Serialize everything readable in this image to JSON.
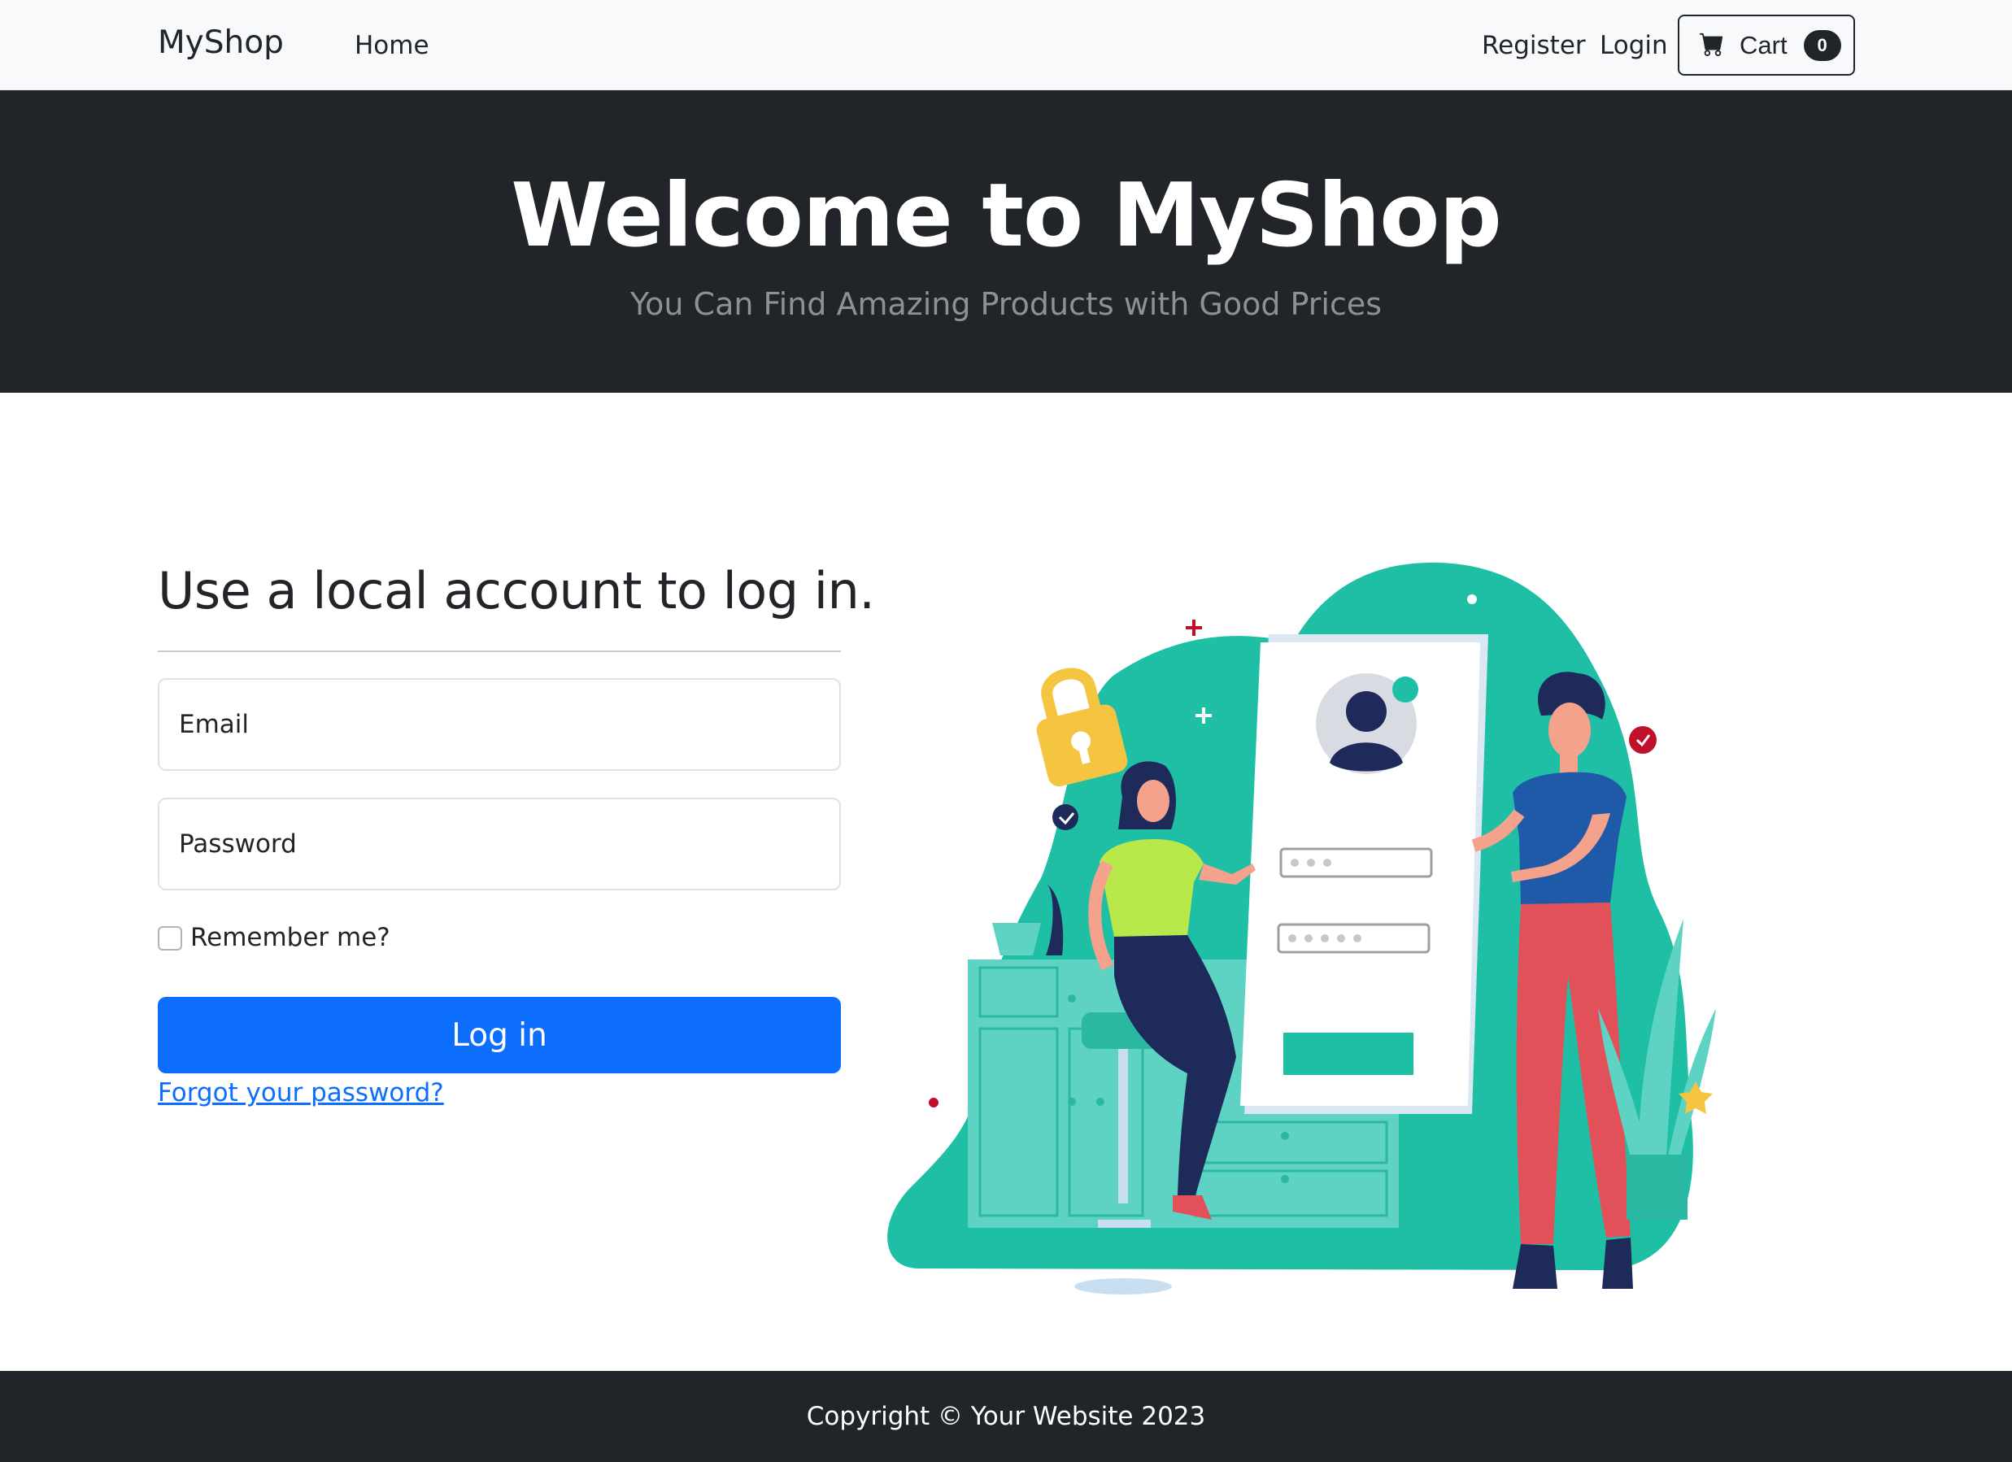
{
  "navbar": {
    "brand": "MyShop",
    "links": {
      "home": "Home",
      "register": "Register",
      "login": "Login"
    },
    "cart": {
      "label": "Cart",
      "count": "0",
      "icon": "cart-icon"
    }
  },
  "hero": {
    "title": "Welcome to MyShop",
    "subtitle": "You Can Find Amazing Products with Good Prices"
  },
  "login_form": {
    "title": "Use a local account to log in.",
    "email_placeholder": "Email",
    "password_placeholder": "Password",
    "remember_label": "Remember me?",
    "submit_label": "Log in",
    "forgot_link": "Forgot your password?"
  },
  "illustration": {
    "subject": "login-illustration"
  },
  "footer": {
    "copyright": "Copyright © Your Website 2023"
  },
  "colors": {
    "primary": "#0d6efd",
    "dark": "#212529",
    "navbar_bg": "#f8f9fa",
    "teal": "#1fbfa6"
  }
}
